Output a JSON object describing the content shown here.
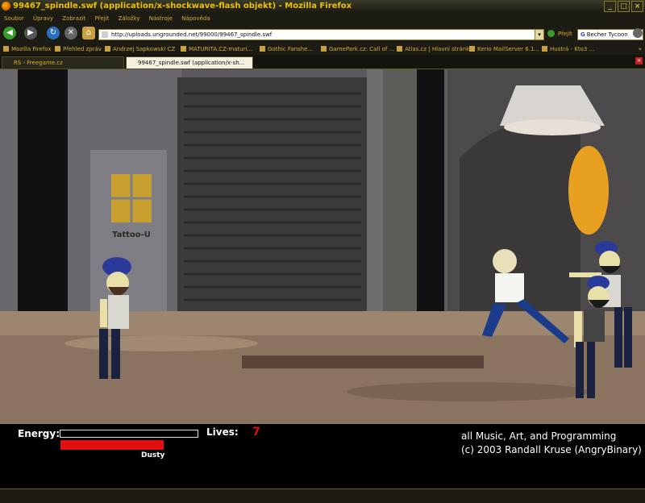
{
  "window": {
    "title": "99467_spindle.swf (application/x-shockwave-flash objekt) - Mozilla Firefox"
  },
  "menu": [
    "Soubor",
    "Úpravy",
    "Zobrazit",
    "Přejít",
    "Záložky",
    "Nástroje",
    "Nápověda"
  ],
  "nav": {
    "url": "http://uploads.ungrounded.net/99000/99467_spindle.swf",
    "go_label": "Přejít",
    "search_value": "Becher Tycoon"
  },
  "bookmarks": [
    "Mozilla Firefox",
    "Přehled zpráv",
    "Andrzej Sapkowski CZ",
    "MATURITA.CZ-maturi...",
    "Gothic Fanshe...",
    "GamePark.cz: Call of ...",
    "Atlas.cz | Hlavní stránka",
    "Kerio MailServer 6.1...",
    "Hustrá - Kto3 ... "
  ],
  "tabs": [
    "RS - Freegame.cz",
    "99467_spindle.swf (application/x-sh..."
  ],
  "game": {
    "sign_text": "Tattoo-U",
    "energy_label": "Energy:",
    "energy_level": 0.0,
    "lives_label": "Lives:",
    "lives_value": "7",
    "enemy_name": "Dusty",
    "credits_line1": "all Music, Art, and Programming",
    "credits_line2": "(c) 2003 Randall Kruse (AngryBinary)"
  }
}
